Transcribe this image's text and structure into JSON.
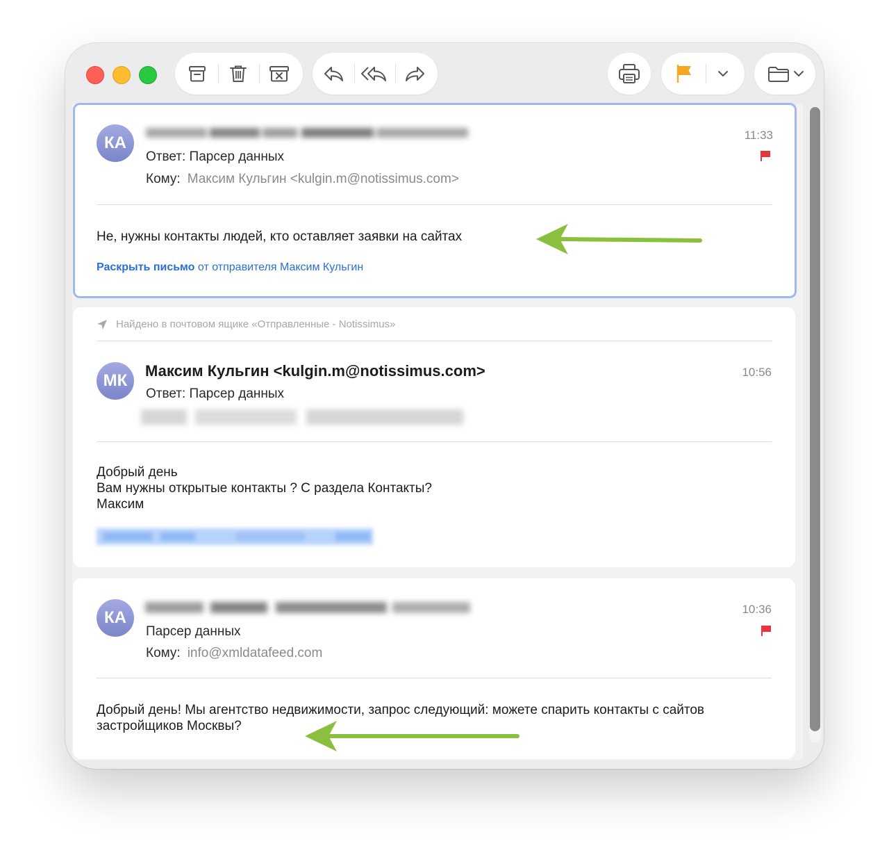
{
  "toolbar": {
    "archive_icon": "archive-box-icon",
    "trash_icon": "trash-icon",
    "junk_icon": "junk-box-icon",
    "reply_icon": "reply-icon",
    "reply_all_icon": "reply-all-icon",
    "forward_icon": "forward-icon",
    "print_icon": "printer-icon",
    "flag_icon": "flag-icon",
    "flag_color": "#f5a623",
    "move_icon": "folder-icon"
  },
  "messages": [
    {
      "avatar": "КА",
      "subject": "Ответ: Парсер данных",
      "to_label": "Кому:",
      "to_value": "Максим Кульгин <kulgin.m@notissimus.com>",
      "time": "11:33",
      "flagged": true,
      "body": "Не, нужны контакты людей, кто оставляет заявки на сайтах",
      "expand_link_bold": "Раскрыть письмо",
      "expand_link_rest": "от отправителя Максим Кульгин"
    },
    {
      "found_in": "Найдено в почтовом ящике «Отправленные - Notissimus»",
      "avatar": "МК",
      "sender": "Максим Кульгин <kulgin.m@notissimus.com>",
      "subject": "Ответ: Парсер данных",
      "time": "10:56",
      "body_lines": [
        "Добрый день",
        "Вам нужны открытые контакты ? С раздела Контакты?",
        "Максим"
      ]
    },
    {
      "avatar": "КА",
      "subject": "Парсер данных",
      "to_label": "Кому:",
      "to_value": "info@xmldatafeed.com",
      "time": "10:36",
      "flagged": true,
      "body_lines": [
        "Добрый день! Мы агентство недвижимости, запрос следующий: можете спарить контакты с сайтов",
        "застройщиков Москвы?"
      ]
    }
  ],
  "colors": {
    "accent_link": "#2a6fd6",
    "flag_red": "#e8343a",
    "annotation_arrow": "#8cbf3f",
    "selection_border": "#9fb9ee"
  }
}
